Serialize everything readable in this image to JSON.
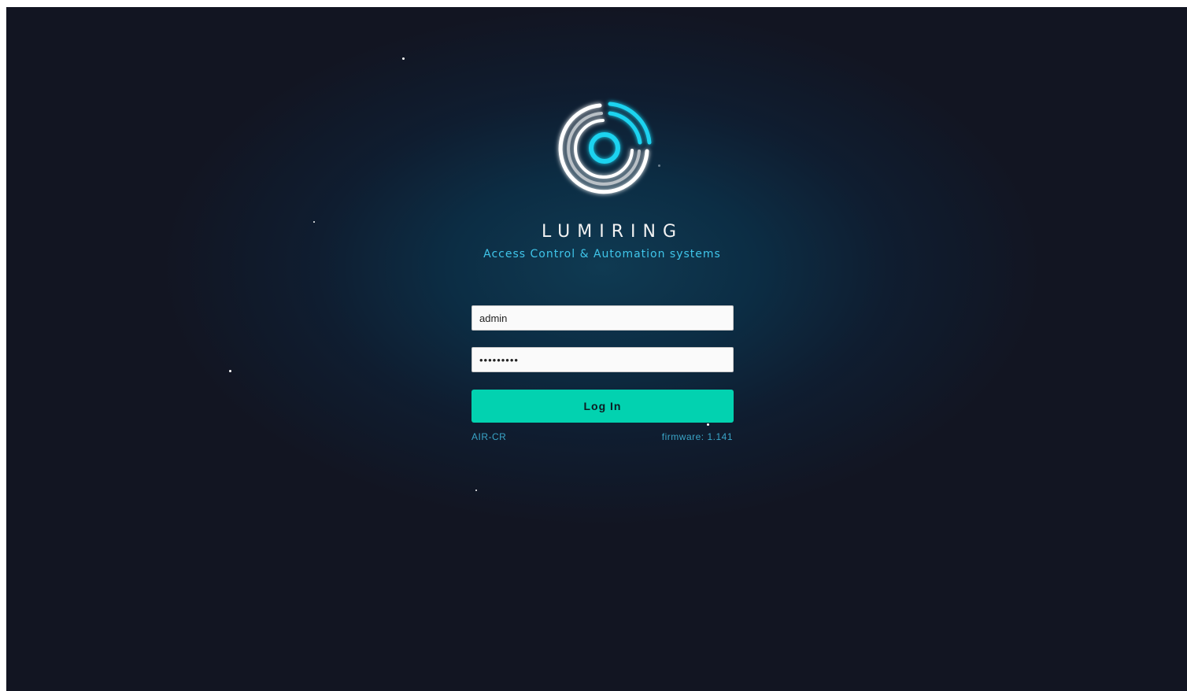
{
  "brand": {
    "name": "LUMIRING",
    "tagline": "Access Control & Automation systems"
  },
  "login": {
    "username_value": "admin",
    "password_value": "•••••••••",
    "button_label": "Log In"
  },
  "footer": {
    "device": "AIR-CR",
    "firmware": "firmware: 1.141"
  },
  "colors": {
    "accent": "#02d2b0",
    "cyan": "#1fd3f0",
    "link": "#3aa5c8",
    "background": "#121522"
  },
  "icons": [
    "lumiring-logo-icon"
  ]
}
